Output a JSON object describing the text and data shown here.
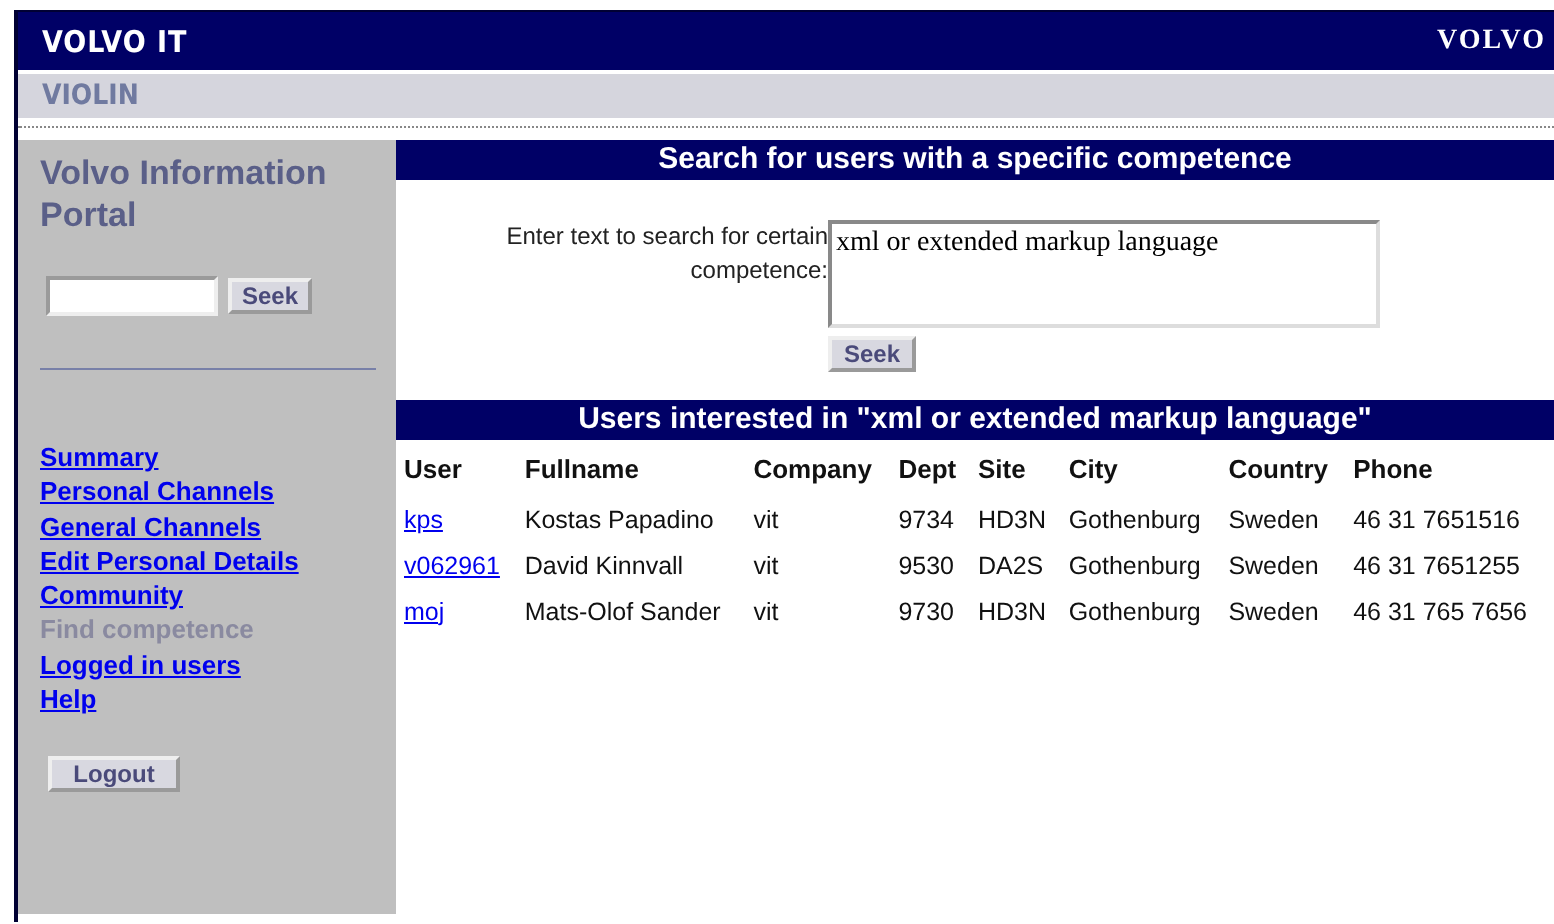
{
  "header": {
    "title": "VOLVO IT",
    "logo": "VOLVO"
  },
  "subheader": {
    "title": "VIOLIN"
  },
  "sidebar": {
    "title": "Volvo Information Portal",
    "search": {
      "button": "Seek"
    },
    "items": [
      {
        "label": "Summary",
        "selected": false
      },
      {
        "label": "Personal Channels",
        "selected": false
      },
      {
        "label": "General Channels",
        "selected": false
      },
      {
        "label": "Edit Personal Details",
        "selected": false
      },
      {
        "label": "Community",
        "selected": false
      },
      {
        "label": "Find competence",
        "selected": true
      },
      {
        "label": "Logged in users",
        "selected": false
      },
      {
        "label": "Help",
        "selected": false
      }
    ],
    "logout": "Logout"
  },
  "search_panel": {
    "title": "Search for users with a specific competence",
    "label": "Enter text to search for certain competence:",
    "value": "xml or extended markup language",
    "button": "Seek"
  },
  "results": {
    "title": "Users interested in \"xml or extended markup language\"",
    "columns": [
      "User",
      "Fullname",
      "Company",
      "Dept",
      "Site",
      "City",
      "Country",
      "Phone"
    ],
    "rows": [
      [
        "kps",
        "Kostas Papadino",
        "vit",
        "9734",
        "HD3N",
        "Gothenburg",
        "Sweden",
        "46 31 7651516"
      ],
      [
        "v062961",
        "David Kinnvall",
        "vit",
        "9530",
        "DA2S",
        "Gothenburg",
        "Sweden",
        "46 31 7651255"
      ],
      [
        "moj",
        "Mats-Olof Sander",
        "vit",
        "9730",
        "HD3N",
        "Gothenburg",
        "Sweden",
        "46 31 765 7656"
      ]
    ]
  }
}
